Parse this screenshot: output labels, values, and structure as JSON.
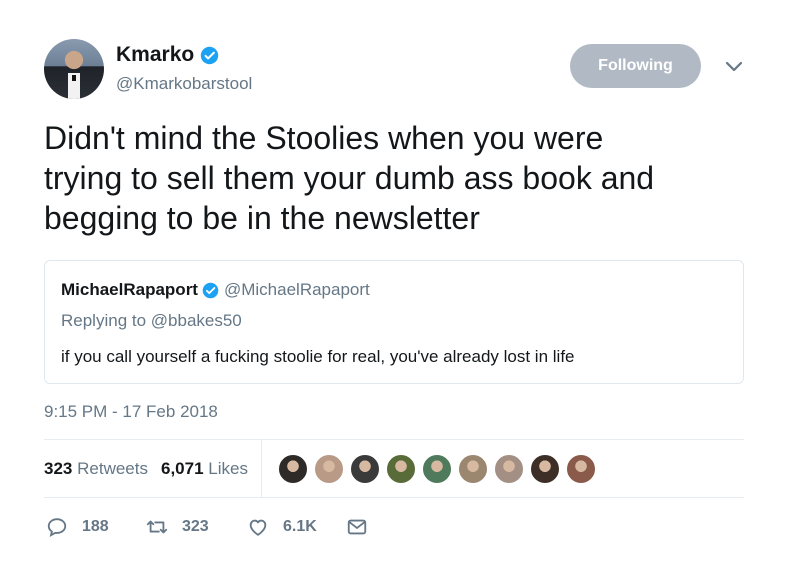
{
  "author": {
    "name": "Kmarko",
    "handle": "@Kmarkobarstool",
    "verified": true
  },
  "follow_button": {
    "label": "Following"
  },
  "tweet": {
    "line1": "Didn't mind the Stoolies when you were",
    "line2": "trying to sell them your dumb ass book and",
    "line3": "begging to be in the newsletter"
  },
  "quoted": {
    "name": "MichaelRapaport",
    "handle": "@MichaelRapaport",
    "replying_to": "Replying to @bbakes50",
    "text": "if you call yourself a fucking stoolie for real, you've already lost in life"
  },
  "timestamp": "9:15 PM - 17 Feb 2018",
  "stats": {
    "retweets_count": "323",
    "retweets_label": "Retweets",
    "likes_count": "6,071",
    "likes_label": "Likes"
  },
  "likers": [
    {
      "color": "#2e2a28"
    },
    {
      "color": "#b89a86"
    },
    {
      "color": "#3a3a3a"
    },
    {
      "color": "#5a6b3a"
    },
    {
      "color": "#4f7a5c"
    },
    {
      "color": "#9b8670"
    },
    {
      "color": "#a38f84"
    },
    {
      "color": "#3d2f27"
    },
    {
      "color": "#8a5a4a"
    }
  ],
  "actions": {
    "replies": "188",
    "retweets": "323",
    "likes": "6.1K"
  },
  "colors": {
    "accent": "#1da1f2",
    "muted": "#657786",
    "following_bg": "#b1bac4"
  }
}
